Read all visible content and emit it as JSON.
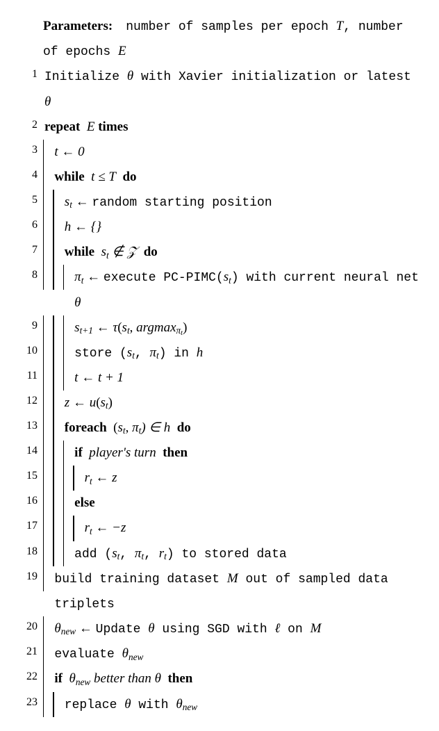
{
  "algorithm": {
    "parameters_label": "Parameters:",
    "parameters_text_part1": "number of samples per epoch ",
    "parameters_var_T": "T",
    "parameters_text_part2": ", number of epochs ",
    "parameters_var_E": "E",
    "lines": {
      "l1a": "Initialize ",
      "l1_theta": "θ",
      "l1b": " with Xavier initialization or latest ",
      "l2_repeat": "repeat ",
      "l2_E": "E",
      "l2_times": " times",
      "l3": "t ← 0",
      "l4_while": "while ",
      "l4_cond": "t ≤ T",
      "l4_do": " do",
      "l5_lhs": "s",
      "l5_sub": "t",
      "l5_arrow": " ← ",
      "l5_rhs": "random starting position",
      "l6": "h ← {}",
      "l7_while": "while ",
      "l7_s": "s",
      "l7_sub": "t",
      "l7_notin": " ∉ 𝒵",
      "l7_do": " do",
      "l8_pi": "π",
      "l8_sub": "t",
      "l8_arrow": " ← ",
      "l8a": "execute PC-PIMC(",
      "l8_s": "s",
      "l8_ssub": "t",
      "l8b": ") with current neural net ",
      "l8_theta": "θ",
      "l9_s": "s",
      "l9_sub": "t+1",
      "l9_arrow": " ← ",
      "l9_tau": "τ",
      "l9_open": "(",
      "l9_s2": "s",
      "l9_s2sub": "t",
      "l9_comma": ", ",
      "l9_argmax": "argmax",
      "l9_amaxsub": "π",
      "l9_amaxsub2": "t",
      "l9_close": ")",
      "l10a": "store (",
      "l10_s": "s",
      "l10_ssub": "t",
      "l10_comma": ", ",
      "l10_pi": "π",
      "l10_psub": "t",
      "l10b": ") in ",
      "l10_h": "h",
      "l11": "t ← t + 1",
      "l12_z": "z",
      "l12_arrow": " ← ",
      "l12_u": "u",
      "l12_open": "(",
      "l12_s": "s",
      "l12_sub": "t",
      "l12_close": ")",
      "l13_foreach": "foreach ",
      "l13_open": "(",
      "l13_s": "s",
      "l13_ssub": "t",
      "l13_comma": ", ",
      "l13_pi": "π",
      "l13_psub": "t",
      "l13_close": ") ∈ h",
      "l13_do": " do",
      "l14_if": "if ",
      "l14_cond": "player's turn",
      "l14_then": " then",
      "l15_r": "r",
      "l15_sub": "t",
      "l15_arrow": " ← ",
      "l15_z": "z",
      "l16_else": "else",
      "l17_r": "r",
      "l17_sub": "t",
      "l17_arrow": " ← −",
      "l17_z": "z",
      "l18a": "add (",
      "l18_s": "s",
      "l18_ssub": "t",
      "l18_c1": ", ",
      "l18_pi": "π",
      "l18_psub": "t",
      "l18_c2": ", ",
      "l18_r": "r",
      "l18_rsub": "t",
      "l18b": ") to stored data",
      "l19": "build training dataset ",
      "l19_M": "M",
      "l19b": " out of sampled data triplets",
      "l20_th": "θ",
      "l20_sub": "new",
      "l20_arrow": " ← ",
      "l20a": "Update ",
      "l20_theta": "θ",
      "l20b": " using SGD with ",
      "l20_ell": "ℓ",
      "l20c": " on ",
      "l20_M": "M",
      "l21a": "evaluate ",
      "l21_th": "θ",
      "l21_sub": "new",
      "l22_if": "if ",
      "l22_thn": "θ",
      "l22_thnsub": "new",
      "l22_mid": " better than ",
      "l22_th": "θ",
      "l22_then": " then",
      "l23a": "replace ",
      "l23_th": "θ",
      "l23b": " with ",
      "l23_thn": "θ",
      "l23_sub": "new"
    }
  }
}
